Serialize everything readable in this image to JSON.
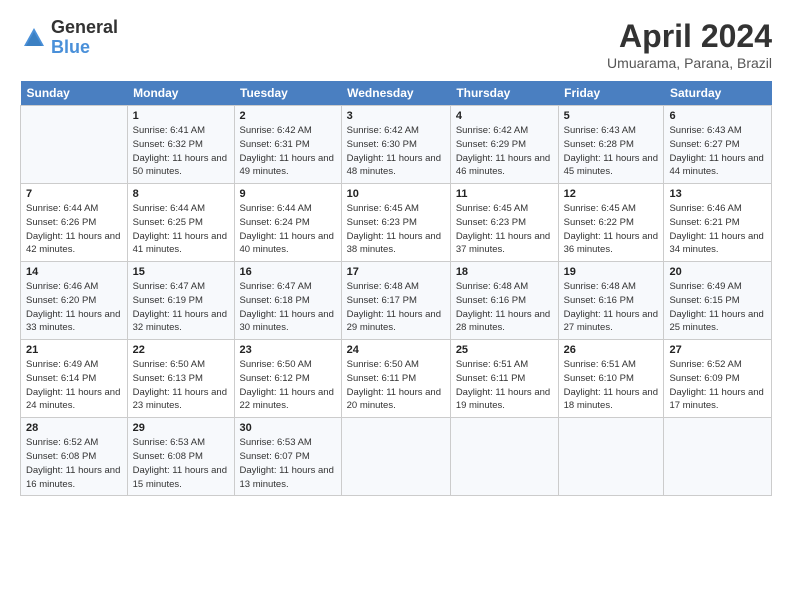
{
  "logo": {
    "general": "General",
    "blue": "Blue"
  },
  "title": "April 2024",
  "subtitle": "Umuarama, Parana, Brazil",
  "headers": [
    "Sunday",
    "Monday",
    "Tuesday",
    "Wednesday",
    "Thursday",
    "Friday",
    "Saturday"
  ],
  "weeks": [
    [
      {
        "num": "",
        "sunrise": "",
        "sunset": "",
        "daylight": ""
      },
      {
        "num": "1",
        "sunrise": "Sunrise: 6:41 AM",
        "sunset": "Sunset: 6:32 PM",
        "daylight": "Daylight: 11 hours and 50 minutes."
      },
      {
        "num": "2",
        "sunrise": "Sunrise: 6:42 AM",
        "sunset": "Sunset: 6:31 PM",
        "daylight": "Daylight: 11 hours and 49 minutes."
      },
      {
        "num": "3",
        "sunrise": "Sunrise: 6:42 AM",
        "sunset": "Sunset: 6:30 PM",
        "daylight": "Daylight: 11 hours and 48 minutes."
      },
      {
        "num": "4",
        "sunrise": "Sunrise: 6:42 AM",
        "sunset": "Sunset: 6:29 PM",
        "daylight": "Daylight: 11 hours and 46 minutes."
      },
      {
        "num": "5",
        "sunrise": "Sunrise: 6:43 AM",
        "sunset": "Sunset: 6:28 PM",
        "daylight": "Daylight: 11 hours and 45 minutes."
      },
      {
        "num": "6",
        "sunrise": "Sunrise: 6:43 AM",
        "sunset": "Sunset: 6:27 PM",
        "daylight": "Daylight: 11 hours and 44 minutes."
      }
    ],
    [
      {
        "num": "7",
        "sunrise": "Sunrise: 6:44 AM",
        "sunset": "Sunset: 6:26 PM",
        "daylight": "Daylight: 11 hours and 42 minutes."
      },
      {
        "num": "8",
        "sunrise": "Sunrise: 6:44 AM",
        "sunset": "Sunset: 6:25 PM",
        "daylight": "Daylight: 11 hours and 41 minutes."
      },
      {
        "num": "9",
        "sunrise": "Sunrise: 6:44 AM",
        "sunset": "Sunset: 6:24 PM",
        "daylight": "Daylight: 11 hours and 40 minutes."
      },
      {
        "num": "10",
        "sunrise": "Sunrise: 6:45 AM",
        "sunset": "Sunset: 6:23 PM",
        "daylight": "Daylight: 11 hours and 38 minutes."
      },
      {
        "num": "11",
        "sunrise": "Sunrise: 6:45 AM",
        "sunset": "Sunset: 6:23 PM",
        "daylight": "Daylight: 11 hours and 37 minutes."
      },
      {
        "num": "12",
        "sunrise": "Sunrise: 6:45 AM",
        "sunset": "Sunset: 6:22 PM",
        "daylight": "Daylight: 11 hours and 36 minutes."
      },
      {
        "num": "13",
        "sunrise": "Sunrise: 6:46 AM",
        "sunset": "Sunset: 6:21 PM",
        "daylight": "Daylight: 11 hours and 34 minutes."
      }
    ],
    [
      {
        "num": "14",
        "sunrise": "Sunrise: 6:46 AM",
        "sunset": "Sunset: 6:20 PM",
        "daylight": "Daylight: 11 hours and 33 minutes."
      },
      {
        "num": "15",
        "sunrise": "Sunrise: 6:47 AM",
        "sunset": "Sunset: 6:19 PM",
        "daylight": "Daylight: 11 hours and 32 minutes."
      },
      {
        "num": "16",
        "sunrise": "Sunrise: 6:47 AM",
        "sunset": "Sunset: 6:18 PM",
        "daylight": "Daylight: 11 hours and 30 minutes."
      },
      {
        "num": "17",
        "sunrise": "Sunrise: 6:48 AM",
        "sunset": "Sunset: 6:17 PM",
        "daylight": "Daylight: 11 hours and 29 minutes."
      },
      {
        "num": "18",
        "sunrise": "Sunrise: 6:48 AM",
        "sunset": "Sunset: 6:16 PM",
        "daylight": "Daylight: 11 hours and 28 minutes."
      },
      {
        "num": "19",
        "sunrise": "Sunrise: 6:48 AM",
        "sunset": "Sunset: 6:16 PM",
        "daylight": "Daylight: 11 hours and 27 minutes."
      },
      {
        "num": "20",
        "sunrise": "Sunrise: 6:49 AM",
        "sunset": "Sunset: 6:15 PM",
        "daylight": "Daylight: 11 hours and 25 minutes."
      }
    ],
    [
      {
        "num": "21",
        "sunrise": "Sunrise: 6:49 AM",
        "sunset": "Sunset: 6:14 PM",
        "daylight": "Daylight: 11 hours and 24 minutes."
      },
      {
        "num": "22",
        "sunrise": "Sunrise: 6:50 AM",
        "sunset": "Sunset: 6:13 PM",
        "daylight": "Daylight: 11 hours and 23 minutes."
      },
      {
        "num": "23",
        "sunrise": "Sunrise: 6:50 AM",
        "sunset": "Sunset: 6:12 PM",
        "daylight": "Daylight: 11 hours and 22 minutes."
      },
      {
        "num": "24",
        "sunrise": "Sunrise: 6:50 AM",
        "sunset": "Sunset: 6:11 PM",
        "daylight": "Daylight: 11 hours and 20 minutes."
      },
      {
        "num": "25",
        "sunrise": "Sunrise: 6:51 AM",
        "sunset": "Sunset: 6:11 PM",
        "daylight": "Daylight: 11 hours and 19 minutes."
      },
      {
        "num": "26",
        "sunrise": "Sunrise: 6:51 AM",
        "sunset": "Sunset: 6:10 PM",
        "daylight": "Daylight: 11 hours and 18 minutes."
      },
      {
        "num": "27",
        "sunrise": "Sunrise: 6:52 AM",
        "sunset": "Sunset: 6:09 PM",
        "daylight": "Daylight: 11 hours and 17 minutes."
      }
    ],
    [
      {
        "num": "28",
        "sunrise": "Sunrise: 6:52 AM",
        "sunset": "Sunset: 6:08 PM",
        "daylight": "Daylight: 11 hours and 16 minutes."
      },
      {
        "num": "29",
        "sunrise": "Sunrise: 6:53 AM",
        "sunset": "Sunset: 6:08 PM",
        "daylight": "Daylight: 11 hours and 15 minutes."
      },
      {
        "num": "30",
        "sunrise": "Sunrise: 6:53 AM",
        "sunset": "Sunset: 6:07 PM",
        "daylight": "Daylight: 11 hours and 13 minutes."
      },
      {
        "num": "",
        "sunrise": "",
        "sunset": "",
        "daylight": ""
      },
      {
        "num": "",
        "sunrise": "",
        "sunset": "",
        "daylight": ""
      },
      {
        "num": "",
        "sunrise": "",
        "sunset": "",
        "daylight": ""
      },
      {
        "num": "",
        "sunrise": "",
        "sunset": "",
        "daylight": ""
      }
    ]
  ]
}
